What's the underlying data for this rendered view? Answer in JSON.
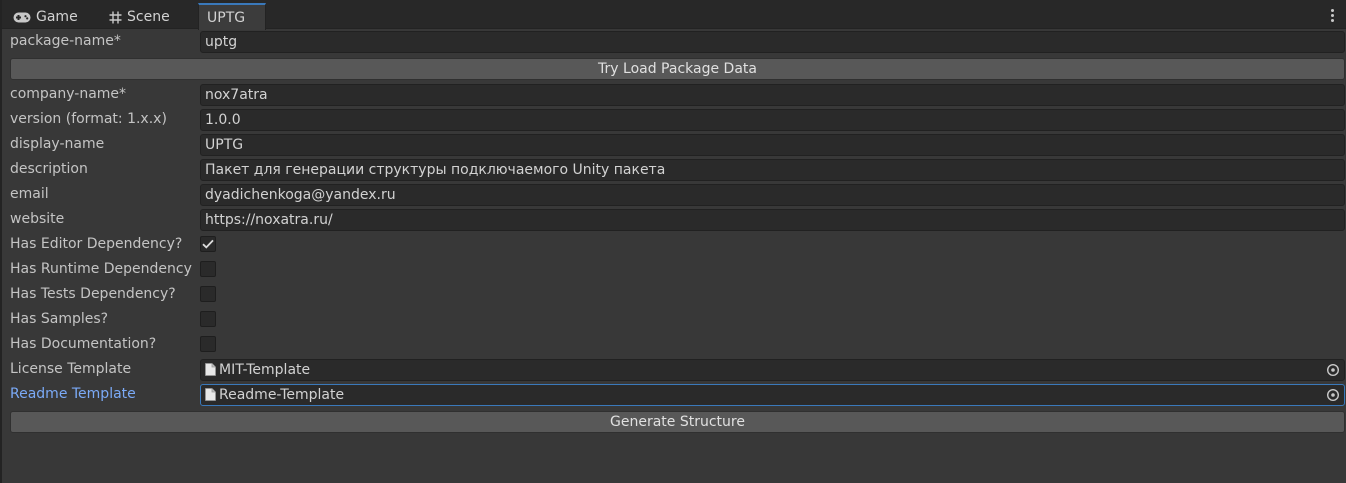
{
  "tabs": [
    {
      "label": "Game",
      "icon": "gamepad-icon"
    },
    {
      "label": "Scene",
      "icon": "grid-icon"
    },
    {
      "label": "UPTG",
      "active": true
    }
  ],
  "form": {
    "package_name": {
      "label": "package-name*",
      "value": "uptg"
    },
    "load_button": "Try Load Package Data",
    "company_name": {
      "label": "company-name*",
      "value": "nox7atra"
    },
    "version": {
      "label": "version (format: 1.x.x)",
      "value": "1.0.0"
    },
    "display_name": {
      "label": "display-name",
      "value": "UPTG"
    },
    "description": {
      "label": "description",
      "value": "Пакет для генерации структуры подключаемого Unity пакета"
    },
    "email": {
      "label": "email",
      "value": "dyadichenkoga@yandex.ru"
    },
    "website": {
      "label": "website",
      "value": "https://noxatra.ru/"
    },
    "has_editor_dependency": {
      "label": "Has Editor Dependency?",
      "checked": true
    },
    "has_runtime_dependency": {
      "label": "Has Runtime Dependency",
      "checked": false
    },
    "has_tests_dependency": {
      "label": "Has Tests Dependency?",
      "checked": false
    },
    "has_samples": {
      "label": "Has Samples?",
      "checked": false
    },
    "has_documentation": {
      "label": "Has Documentation?",
      "checked": false
    },
    "license_template": {
      "label": "License Template",
      "value": "MIT-Template"
    },
    "readme_template": {
      "label": "Readme Template",
      "value": "Readme-Template"
    },
    "generate_button": "Generate Structure"
  },
  "colors": {
    "background": "#383838",
    "field": "#2a2a2a",
    "button": "#585858",
    "accent": "#3a79bb",
    "focused_label": "#7baaf7"
  }
}
